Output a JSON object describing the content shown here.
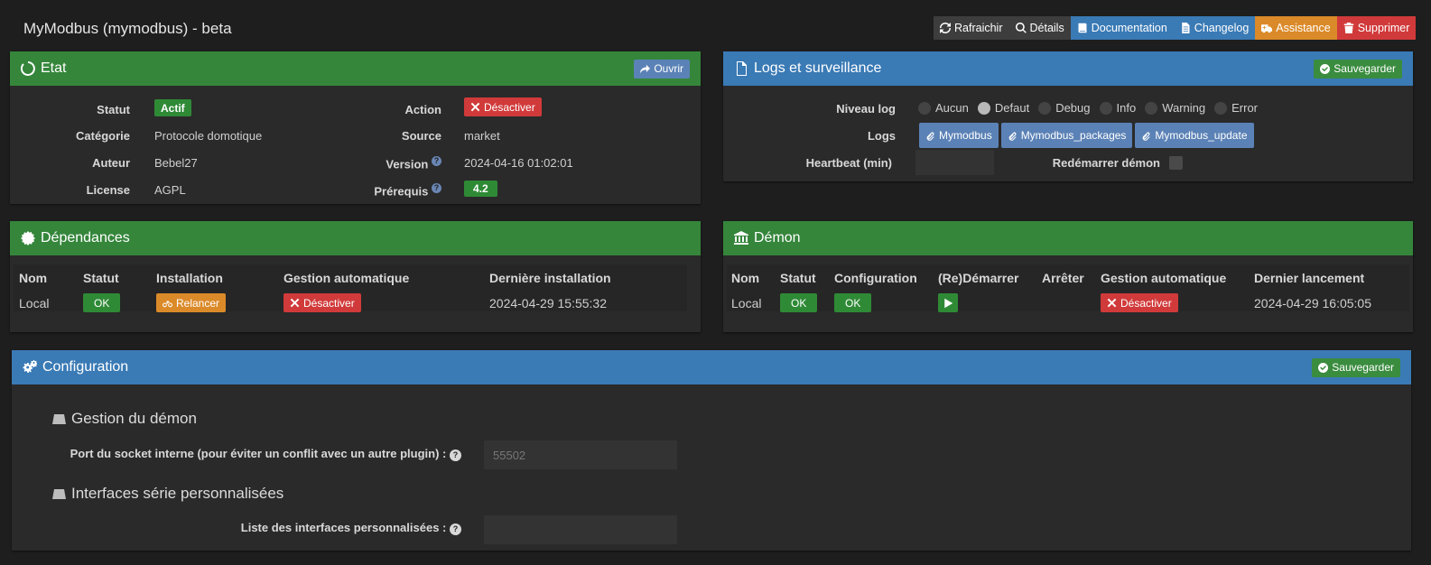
{
  "title": "MyModbus (mymodbus) - beta",
  "toolbar": {
    "refresh": "Rafraichir",
    "details": "Détails",
    "documentation": "Documentation",
    "changelog": "Changelog",
    "assistance": "Assistance",
    "delete": "Supprimer"
  },
  "etat": {
    "title": "Etat",
    "open_button": "Ouvrir",
    "statut_label": "Statut",
    "statut_value": "Actif",
    "categorie_label": "Catégorie",
    "categorie_value": "Protocole domotique",
    "auteur_label": "Auteur",
    "auteur_value": "Bebel27",
    "license_label": "License",
    "license_value": "AGPL",
    "action_label": "Action",
    "action_button": "Désactiver",
    "source_label": "Source",
    "source_value": "market",
    "version_label": "Version",
    "version_value": "2024-04-16 01:02:01",
    "prerequis_label": "Prérequis",
    "prerequis_value": "4.2"
  },
  "logs": {
    "title": "Logs et surveillance",
    "save_button": "Sauvegarder",
    "niveau_label": "Niveau log",
    "levels": [
      "Aucun",
      "Defaut",
      "Debug",
      "Info",
      "Warning",
      "Error"
    ],
    "selected_level": "Defaut",
    "logs_label": "Logs",
    "log_buttons": [
      "Mymodbus",
      "Mymodbus_packages",
      "Mymodbus_update"
    ],
    "heartbeat_label": "Heartbeat (min)",
    "heartbeat_value": "",
    "restart_label": "Redémarrer démon"
  },
  "dependances": {
    "title": "Dépendances",
    "headers": [
      "Nom",
      "Statut",
      "Installation",
      "Gestion automatique",
      "Dernière installation"
    ],
    "row": {
      "nom": "Local",
      "statut": "OK",
      "installation": "Relancer",
      "gestion": "Désactiver",
      "derniere": "2024-04-29 15:55:32"
    }
  },
  "demon": {
    "title": "Démon",
    "headers": [
      "Nom",
      "Statut",
      "Configuration",
      "(Re)Démarrer",
      "Arrêter",
      "Gestion automatique",
      "Dernier lancement"
    ],
    "row": {
      "nom": "Local",
      "statut": "OK",
      "configuration": "OK",
      "gestion": "Désactiver",
      "dernier": "2024-04-29 16:05:05"
    }
  },
  "configuration": {
    "title": "Configuration",
    "save_button": "Sauvegarder",
    "section1": "Gestion du démon",
    "port_label": "Port du socket interne (pour éviter un conflit avec un autre plugin) :",
    "port_placeholder": "55502",
    "section2": "Interfaces série personnalisées",
    "interfaces_label": "Liste des interfaces personnalisées :",
    "interfaces_value": ""
  }
}
